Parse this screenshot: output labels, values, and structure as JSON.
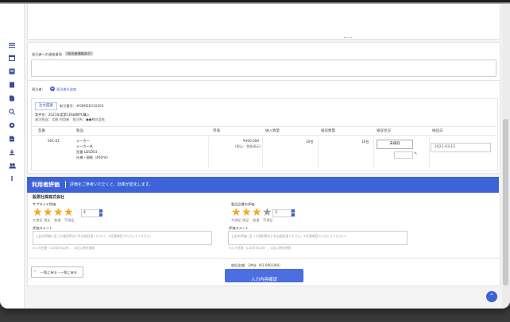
{
  "sidebar": {
    "icons": [
      "menu-icon",
      "calendar-icon",
      "list-icon",
      "document-icon",
      "file-icon",
      "search-icon",
      "settings-icon",
      "note-icon",
      "users-icon",
      "download-icon",
      "group-icon",
      "info-icon"
    ]
  },
  "notes": {
    "label": "発注者への連絡事項",
    "badge": "発注者連絡あり"
  },
  "orderer": {
    "label": "発注者：",
    "add_button": "発注者を追加"
  },
  "order": {
    "tab_label": "注文履歴",
    "order_no": "取引番号：#OEM20210203",
    "title_line": "案件名：2021年度第1四半期PC購入",
    "meta_line": "発注担当：太郎 利用者　発注先：●●株式会社"
  },
  "table": {
    "headers": [
      "型番",
      "製品",
      "単価",
      "納入数量",
      "検収数量",
      "検収状況",
      "納品日"
    ],
    "row": {
      "model": "001-01",
      "product_lines": [
        "メーカー",
        "メーカー名",
        "型番 LDSD03",
        "仕様・規格（400ml）"
      ],
      "price_lines": [
        "¥300,000",
        "(税込：税抜表示)"
      ],
      "qty_order": "10台",
      "qty_inspect": "10台",
      "status_value": "未検収",
      "date_value": "2021-03-15"
    }
  },
  "evaluation": {
    "title": "利用者評価",
    "subtitle": "評価をご参考いただくと、効率が変化します。",
    "company": "股票社株株式会社",
    "criteria": [
      {
        "label": "サプライヤ評価",
        "score": "4",
        "filled": 4,
        "captions": [
          "大満足",
          "満足",
          "普通",
          "不満足"
        ],
        "comment_label": "評価コメント",
        "placeholder": "上記の評価に至った理由等などを自由記述ください。※任意項目で入力してください。",
        "hint": "※入力任意（100文字以内）、※記入例を参照"
      },
      {
        "label": "製品品質の評価",
        "score": "3",
        "filled": 3,
        "captions": [
          "大満足",
          "満足",
          "普通",
          "不満足"
        ],
        "comment_label": "評価コメント",
        "placeholder": "上記の評価に至った理由等などを自由記述ください。※任意項目で入力してください。",
        "hint": "※入力任意（100文字以内）、※記入例を参照"
      }
    ]
  },
  "footer": {
    "back_label": "一覧に戻る・一覧に戻る",
    "total": "検収金額：1件計（¥1,000,000）",
    "confirm": "入力内容確認"
  },
  "colors": {
    "accent": "#3d63d8",
    "star": "#f5a623",
    "star_empty": "#9a9a9a"
  }
}
